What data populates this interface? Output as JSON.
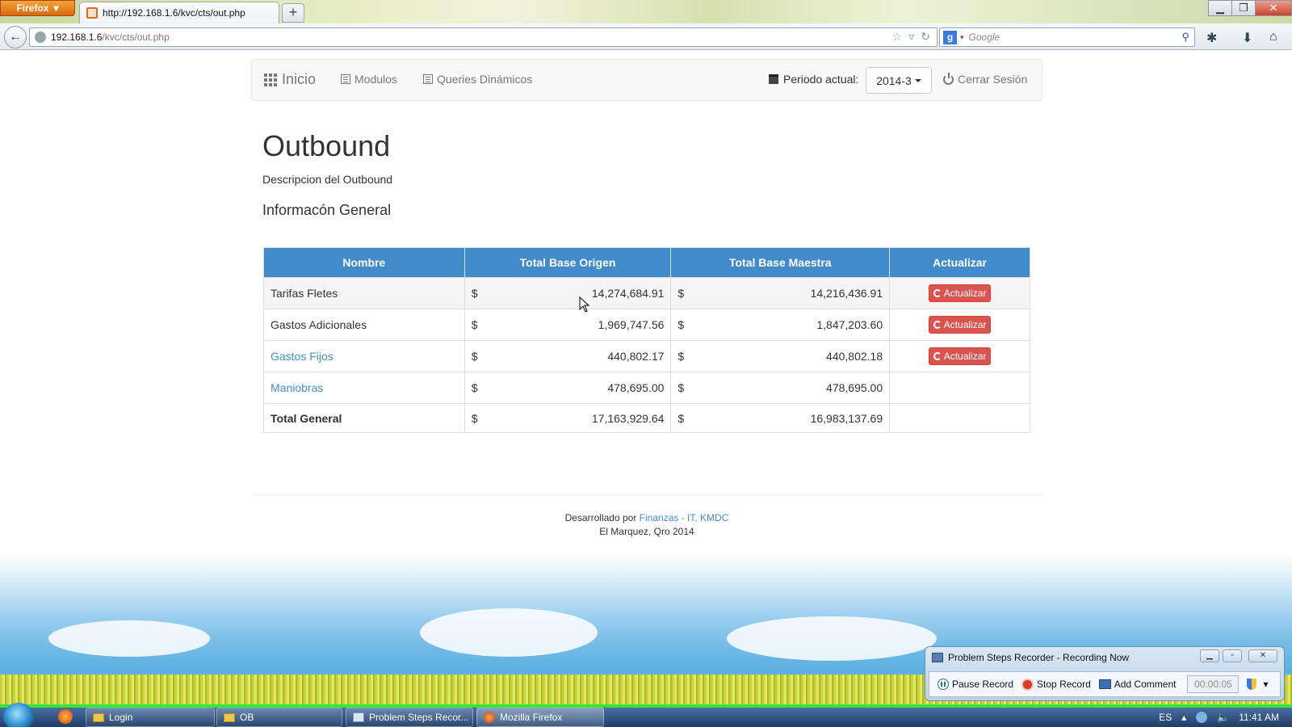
{
  "browser": {
    "menu_button": "Firefox",
    "tab_title": "http://192.168.1.6/kvc/cts/out.php",
    "new_tab": "+",
    "url_host": "192.168.1.6",
    "url_path": "/kvc/cts/out.php",
    "search_placeholder": "Google"
  },
  "app_nav": {
    "brand": "Inicio",
    "links": [
      "Modulos",
      "Queries Dinámicos"
    ],
    "periodo_label": "Periodo actual:",
    "periodo_value": "2014-3",
    "logout": "Cerrar Sesión"
  },
  "page": {
    "title": "Outbound",
    "description": "Descripcion del Outbound",
    "section_title": "Informacón General"
  },
  "table": {
    "headers": [
      "Nombre",
      "Total Base Origen",
      "Total Base Maestra",
      "Actualizar"
    ],
    "currency": "$",
    "button_label": "Actualizar",
    "rows": [
      {
        "name": "Tarifas Fletes",
        "origen": "14,274,684.91",
        "maestra": "14,216,436.91"
      },
      {
        "name": "Gastos Adicionales",
        "origen": "1,969,747.56",
        "maestra": "1,847,203.60"
      },
      {
        "name": "Gastos Fijos",
        "origen": "440,802.17",
        "maestra": "440,802.18"
      },
      {
        "name": "Maniobras",
        "origen": "478,695.00",
        "maestra": "478,695.00"
      }
    ],
    "total": {
      "name": "Total General",
      "origen": "17,163,929.64",
      "maestra": "16,983,137.69"
    }
  },
  "footer": {
    "prefix": "Desarrollado por",
    "link": "Finanzas - IT, KMDC",
    "line2": "El Marquez, Qro 2014"
  },
  "psr": {
    "title": "Problem Steps Recorder - Recording Now",
    "pause": "Pause Record",
    "stop": "Stop Record",
    "comment": "Add Comment",
    "timer": "00:00:05"
  },
  "taskbar": {
    "tasks": [
      "Login",
      "OB",
      "Problem Steps Recor...",
      "Mozilla Firefox"
    ],
    "lang": "ES",
    "clock": "11:41 AM"
  },
  "colors": {
    "primary": "#428bca",
    "danger": "#d9534f",
    "accent_green": "#36e63c"
  }
}
